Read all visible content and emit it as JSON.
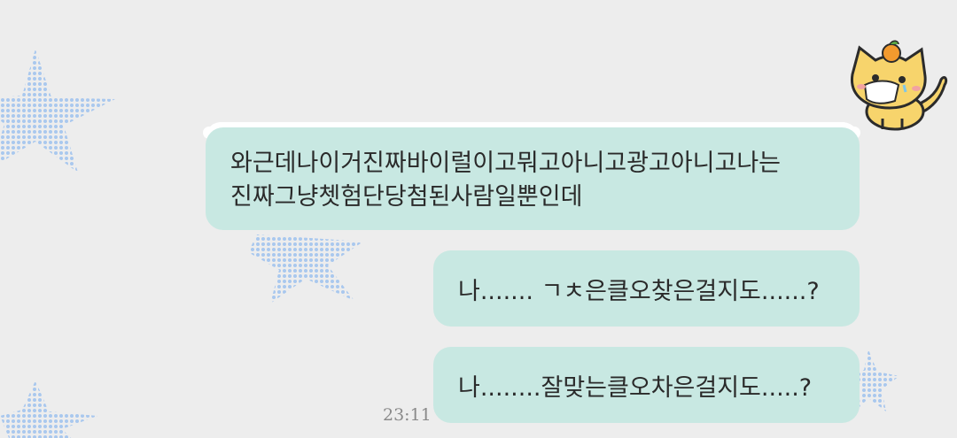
{
  "chat": {
    "messages": [
      {
        "lines": [
          "와근데나이거진짜바이럴이고뭐고아니고광고아니고나는",
          "진짜그냥쳇험단당첨된사람일뿐인데"
        ]
      },
      {
        "text": "나....... ㄱㅊ은클오찾은걸지도......?"
      },
      {
        "text": "나........잘맞는클오차은걸지도.....?"
      }
    ],
    "timestamp": "23:11"
  },
  "decor": {
    "bubble_color": "#c8e8e2",
    "star_color": "#a9c8ee",
    "sticker": "orange-cat-sticker-icon"
  }
}
